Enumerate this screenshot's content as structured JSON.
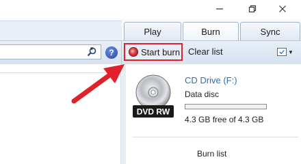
{
  "window": {
    "controls": {
      "minimize_icon": "minimize-icon",
      "maximize_icon": "restore-icon",
      "close_icon": "close-icon"
    }
  },
  "tabs": [
    {
      "label": "Play"
    },
    {
      "label": "Burn",
      "selected": true
    },
    {
      "label": "Sync"
    }
  ],
  "toolbar": {
    "search_placeholder": "",
    "start_burn_label": "Start burn",
    "clear_list_label": "Clear list",
    "help_glyph": "?"
  },
  "burn_pane": {
    "drive_title": "CD Drive (F:)",
    "disc_type": "Data disc",
    "disc_label": "DVD RW",
    "free_space": "4.3 GB free of 4.3 GB",
    "used_fraction": 0,
    "list_title": "Burn list"
  },
  "colors": {
    "highlight_border": "#e0212b",
    "arrow": "#e0212b",
    "link_blue": "#2a6fb4"
  }
}
